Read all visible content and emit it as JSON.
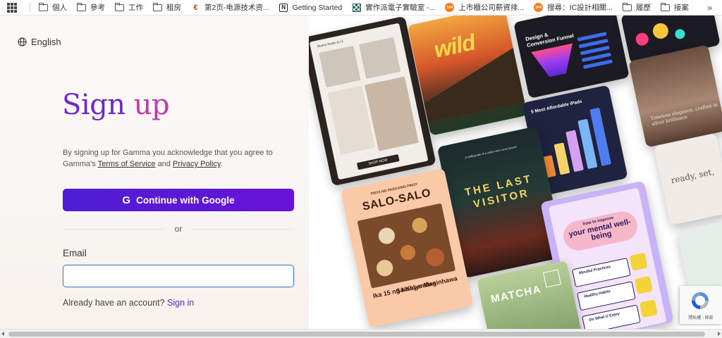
{
  "bookmarks": {
    "items": [
      {
        "label": "個人",
        "icon": "folder-icon"
      },
      {
        "label": "參考",
        "icon": "folder-icon"
      },
      {
        "label": "工作",
        "icon": "folder-icon"
      },
      {
        "label": "租房",
        "icon": "folder-icon"
      },
      {
        "label": "第2页-电源技术资...",
        "icon": "site-favicon",
        "fav": "€"
      },
      {
        "label": "Getting Started",
        "icon": "notion-icon",
        "fav": "N"
      },
      {
        "label": "實作派電子實驗室 -...",
        "icon": "site-favicon"
      },
      {
        "label": "上市櫃公司薪資排...",
        "icon": "site-favicon",
        "fav": "104"
      },
      {
        "label": "搜尋：IC設計相關...",
        "icon": "site-favicon",
        "fav": "104"
      },
      {
        "label": "履歷",
        "icon": "folder-icon"
      },
      {
        "label": "接案",
        "icon": "folder-icon"
      }
    ],
    "more": "»"
  },
  "header": {
    "language": "English"
  },
  "signup": {
    "title_part1": "Sign",
    "title_part2": "up",
    "legal_prefix": "By signing up for Gamma you acknowledge that you agree to Gamma's",
    "terms_link": "Terms of Service",
    "legal_and": "and",
    "privacy_link": "Privacy Policy",
    "legal_suffix": ".",
    "google_icon": "G",
    "google_button": "Continue with Google",
    "divider": "or",
    "email_label": "Email",
    "email_value": "",
    "signin_prompt": "Already have an account?",
    "signin_link": "Sign in"
  },
  "collage": {
    "card_fashion": {
      "header": "Rivera Studio & Lil",
      "cta": "SHOP NOW"
    },
    "card_wild": {
      "title": "wild"
    },
    "card_funnel": {
      "title": "Design & Conversion Funnel"
    },
    "card_ipads": {
      "title": "5 Most Affordable iPads"
    },
    "card_portrait": {
      "text": "Timeless elegance, crafted in silver brilliance"
    },
    "card_visitor": {
      "subtitle": "A chilling tale of a visitor who never leaves",
      "title": "THE LAST VISITOR"
    },
    "card_salo": {
      "kicker": "PISTA NG PAGKAING PINOY",
      "title": "SALO-SALO",
      "date": "Ika 15 ng Nobyembre",
      "place": "Sa Kalye Maginhawa"
    },
    "card_wellbeing": {
      "kicker": "how to improve",
      "title": "your mental well-being",
      "items": [
        "Mindful Practices",
        "Healthy Habits",
        "Do What U Enjoy"
      ]
    },
    "card_matcha": {
      "title": "MATCHA"
    },
    "card_ready": {
      "text": "ready, set,"
    }
  },
  "captcha": {
    "text": "隱私權 - 條款"
  },
  "colors": {
    "accent": "#5a25d6",
    "title_start": "#6d2ac9",
    "title_end": "#c23aa7",
    "input_focus": "#4a7ec9"
  }
}
